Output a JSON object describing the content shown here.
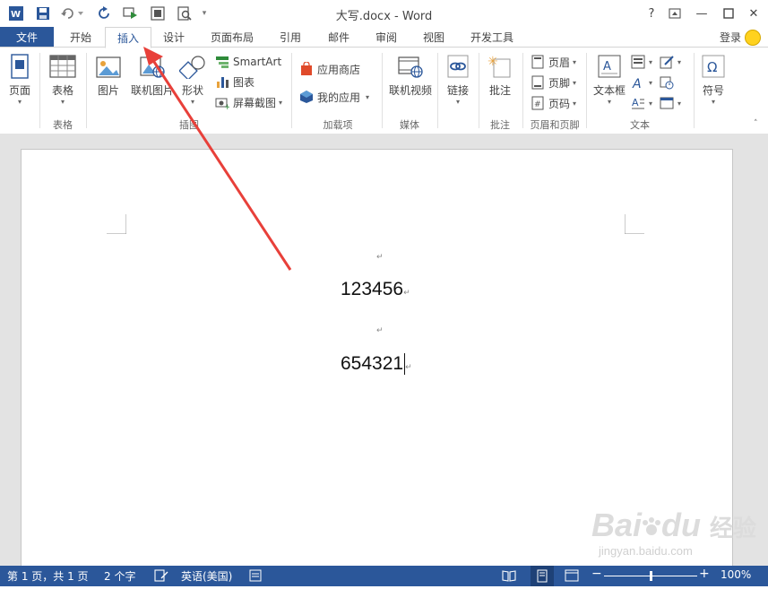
{
  "window": {
    "title": "大写.docx - Word",
    "help": "?",
    "min": "—",
    "close": "✕"
  },
  "tabs": {
    "file": "文件",
    "home": "开始",
    "insert": "插入",
    "design": "设计",
    "layout": "页面布局",
    "references": "引用",
    "mailings": "邮件",
    "review": "审阅",
    "view": "视图",
    "developer": "开发工具",
    "login": "登录"
  },
  "ribbon": {
    "pages": "页面",
    "table": "表格",
    "table_group": "表格",
    "picture": "图片",
    "online_picture": "联机图片",
    "shapes": "形状",
    "smartart": "SmartArt",
    "chart": "图表",
    "screenshot": "屏幕截图",
    "illustrations_group": "插图",
    "store": "应用商店",
    "my_apps": "我的应用",
    "addins_group": "加载项",
    "online_video": "联机视频",
    "media_group": "媒体",
    "link": "链接",
    "comment": "批注",
    "comment_group": "批注",
    "header": "页眉",
    "footer": "页脚",
    "page_number": "页码",
    "header_footer_group": "页眉和页脚",
    "textbox": "文本框",
    "text_group": "文本",
    "symbol": "符号"
  },
  "document": {
    "line1": "123456",
    "line2": "654321",
    "para": "↵"
  },
  "status": {
    "page": "第 1 页，共 1 页",
    "words": "2 个字",
    "language": "英语(美国)",
    "zoom": "100%",
    "minus": "−",
    "plus": "+"
  },
  "watermark": {
    "brand": "Bai",
    "brand2": "du",
    "cn": "经验",
    "url": "jingyan.baidu.com"
  },
  "colors": {
    "accent": "#2b579a",
    "arrow": "#e8403a"
  }
}
